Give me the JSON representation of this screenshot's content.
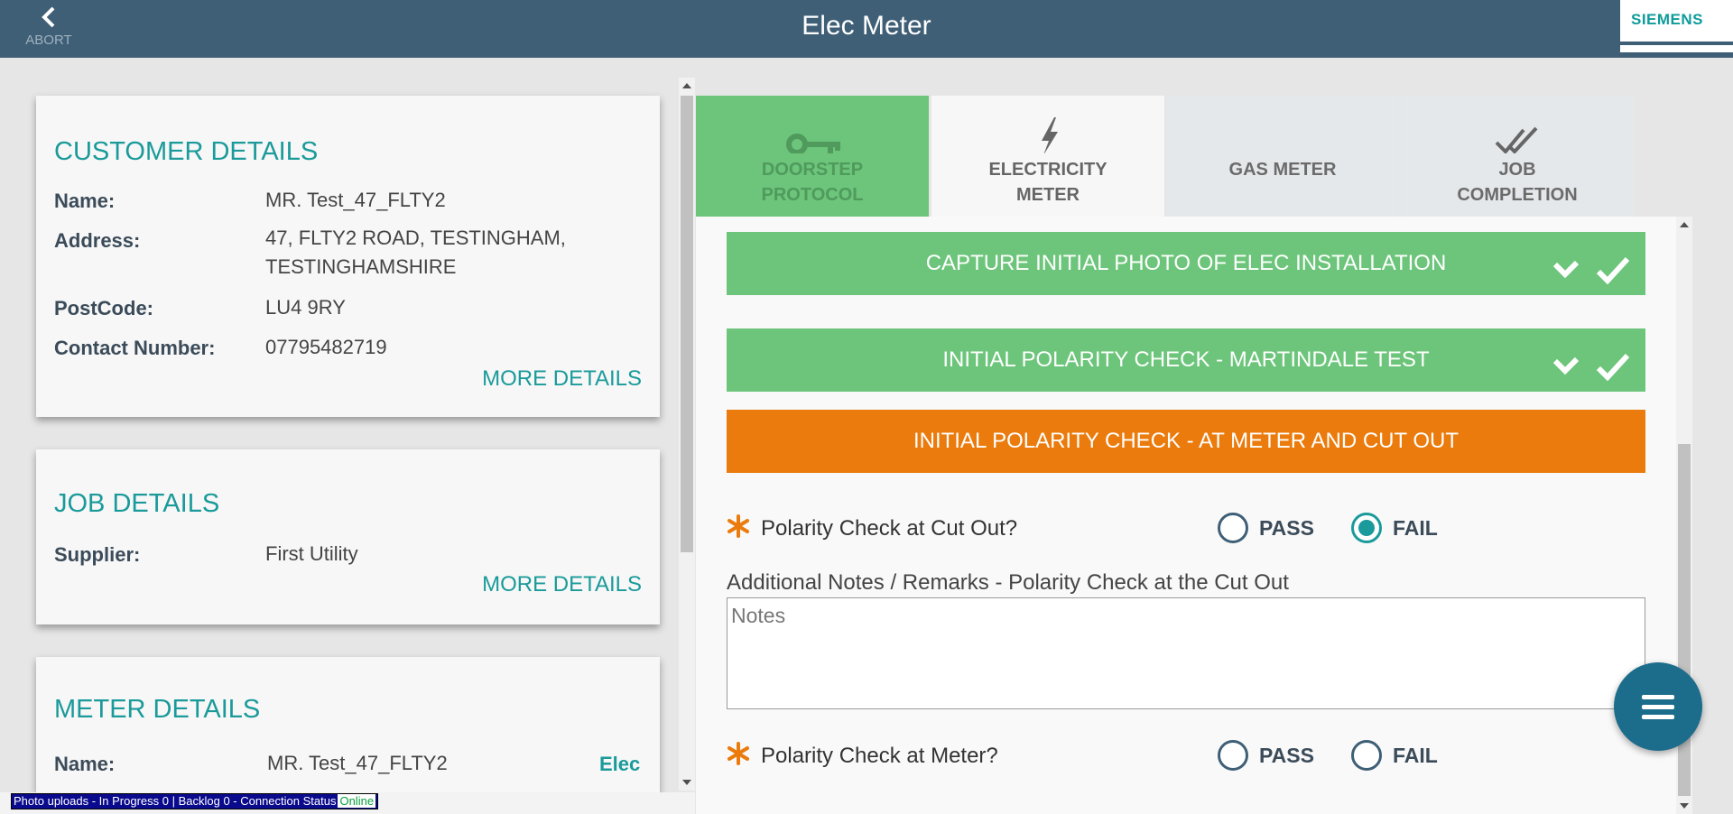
{
  "header": {
    "title": "Elec Meter",
    "abort_label": "ABORT",
    "logo_text": "SIEMENS"
  },
  "customer": {
    "title": "CUSTOMER DETAILS",
    "name_label": "Name:",
    "name_value": "MR. Test_47_FLTY2",
    "address_label": "Address:",
    "address_value": "47, FLTY2 ROAD, TESTINGHAM, TESTINGHAMSHIRE",
    "postcode_label": "PostCode:",
    "postcode_value": "LU4 9RY",
    "contact_label": "Contact Number:",
    "contact_value": "07795482719",
    "more_label": "MORE DETAILS"
  },
  "job": {
    "title": "JOB DETAILS",
    "supplier_label": "Supplier:",
    "supplier_value": "First Utility",
    "more_label": "MORE DETAILS"
  },
  "meter": {
    "title": "METER DETAILS",
    "name_label": "Name:",
    "name_value": "MR. Test_47_FLTY2",
    "type_value": "Elec"
  },
  "tabs": [
    {
      "label_line1": "DOORSTEP",
      "label_line2": "PROTOCOL",
      "icon": "key-icon",
      "state": "complete"
    },
    {
      "label_line1": "ELECTRICITY",
      "label_line2": "METER",
      "icon": "lightning-icon",
      "state": "active"
    },
    {
      "label_line1": "GAS METER",
      "label_line2": "",
      "icon": "none",
      "state": "inactive"
    },
    {
      "label_line1": "JOB",
      "label_line2": "COMPLETION",
      "icon": "double-check-icon",
      "state": "inactive"
    }
  ],
  "sections": [
    {
      "label": "CAPTURE INITIAL PHOTO OF ELEC INSTALLATION",
      "status": "complete"
    },
    {
      "label": "INITIAL POLARITY CHECK - MARTINDALE TEST",
      "status": "complete"
    },
    {
      "label": "INITIAL POLARITY CHECK - AT METER AND CUT OUT",
      "status": "in-progress"
    }
  ],
  "questions": {
    "cutout": {
      "label": "Polarity Check at Cut Out?",
      "pass_label": "PASS",
      "fail_label": "FAIL",
      "selected": "FAIL"
    },
    "meter": {
      "label": "Polarity Check at Meter?",
      "pass_label": "PASS",
      "fail_label": "FAIL",
      "selected": ""
    }
  },
  "notes": {
    "label": "Additional Notes / Remarks - Polarity Check at the Cut Out",
    "placeholder": "Notes",
    "value": ""
  },
  "status_bar": {
    "text": "Photo uploads - In Progress 0 | Backlog 0 - Connection Status",
    "connection": "Online"
  },
  "colors": {
    "header": "#3f5f77",
    "teal": "#1a9a9a",
    "green": "#6cc57a",
    "orange": "#ea7b0c",
    "fab": "#1c6c8c"
  }
}
